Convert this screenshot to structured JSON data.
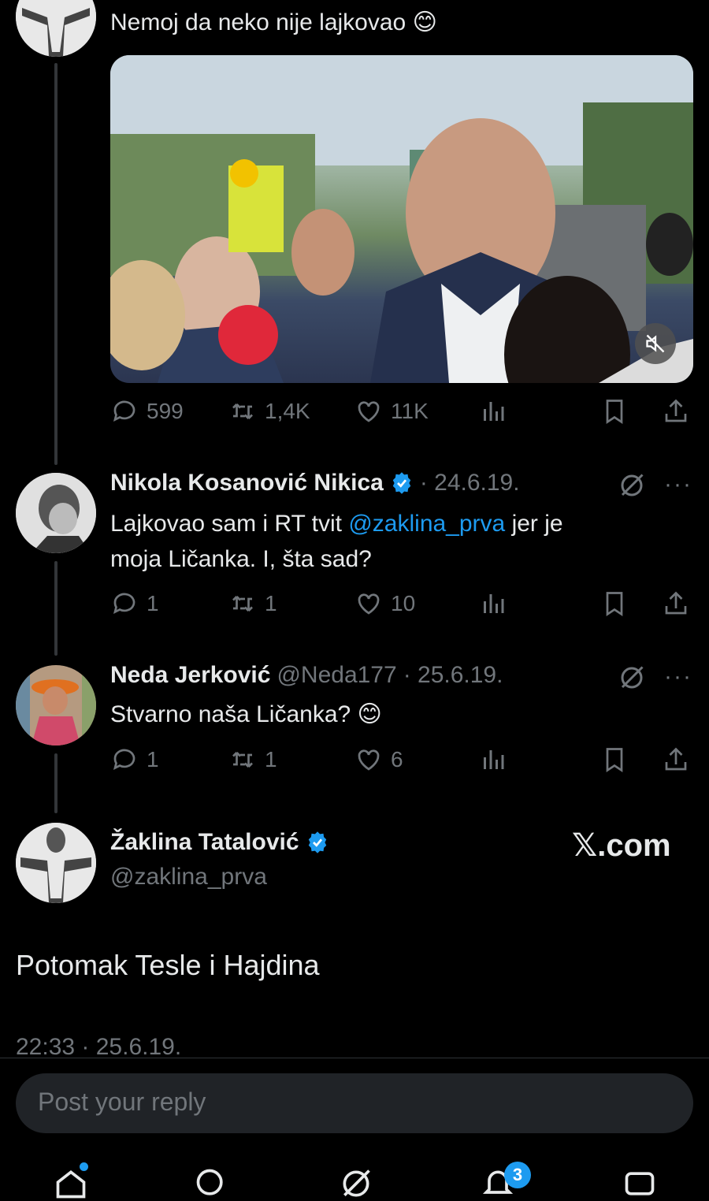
{
  "tweet1": {
    "text": "Nemoj da neko nije lajkovao",
    "emoji": "😊",
    "stats": {
      "replies": "599",
      "reposts": "1,4K",
      "likes": "11K"
    }
  },
  "reply1": {
    "name": "Nikola Kosanović Nikica",
    "date": "· 24.6.19.",
    "text_a": "Lajkovao sam i RT tvit ",
    "mention": "@zaklina_prva",
    "text_b": " jer je",
    "text_c": "moja Ličanka. I, šta sad?",
    "stats": {
      "replies": "1",
      "reposts": "1",
      "likes": "10"
    }
  },
  "reply2": {
    "name": "Neda Jerković",
    "handle": "@Neda177",
    "date": "· 25.6.19.",
    "text": "Stvarno naša Ličanka?",
    "emoji": "😊",
    "stats": {
      "replies": "1",
      "reposts": "1",
      "likes": "6"
    }
  },
  "main": {
    "name": "Žaklina Tatalović",
    "handle": "@zaklina_prva",
    "watermark": "𝕏.com",
    "text": "Potomak Tesle i Hajdina",
    "timestamp": "22:33 · 25.6.19."
  },
  "reply_input": {
    "placeholder": "Post your reply"
  },
  "nav": {
    "notifications_badge": "3"
  },
  "more_label": "···",
  "colors": {
    "accent": "#1d9bf0",
    "muted": "#71767b",
    "text": "#e7e9ea",
    "bg": "#000000"
  },
  "icons": [
    "reply-icon",
    "repost-icon",
    "like-icon",
    "views-icon",
    "bookmark-icon",
    "share-icon",
    "grok-icon",
    "mute-icon",
    "verified-icon",
    "home-icon",
    "search-icon",
    "grok-nav-icon",
    "notifications-icon",
    "messages-icon"
  ]
}
